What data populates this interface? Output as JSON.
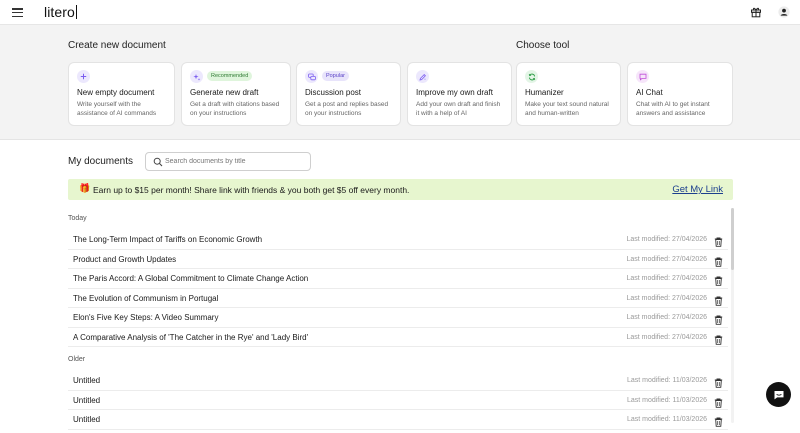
{
  "app": {
    "logo": "litero"
  },
  "create": {
    "title": "Create new document",
    "cards": [
      {
        "title": "New empty document",
        "desc": "Write yourself with the assistance of AI commands",
        "badge": "",
        "icon": "plus-icon",
        "icon_color": "#7a5cf0",
        "icon_bg": "#ece8fd"
      },
      {
        "title": "Generate new draft",
        "desc": "Get a draft with citations based on your instructions",
        "badge": "Recommended",
        "badge_bg": "#dff5dc",
        "badge_color": "#2f7a33",
        "icon": "sparkle-icon",
        "icon_color": "#7a5cf0",
        "icon_bg": "#ece8fd"
      },
      {
        "title": "Discussion post",
        "desc": "Get a post and replies based on your instructions",
        "badge": "Popular",
        "badge_bg": "#e8e4fb",
        "badge_color": "#5a42c7",
        "icon": "chat-bubbles-icon",
        "icon_color": "#7a5cf0",
        "icon_bg": "#ece8fd"
      },
      {
        "title": "Improve my own draft",
        "desc": "Add your own draft and finish it with a help of AI",
        "badge": "",
        "icon": "edit-sparkle-icon",
        "icon_color": "#7a5cf0",
        "icon_bg": "#ece8fd"
      }
    ]
  },
  "tools": {
    "title": "Choose tool",
    "cards": [
      {
        "title": "Humanizer",
        "desc": "Make your text sound natural and human-written",
        "icon": "refresh-icon",
        "icon_color": "#2e9d47",
        "icon_bg": "#e3f5e6"
      },
      {
        "title": "AI Chat",
        "desc": "Chat with AI to get instant answers and assistance",
        "icon": "message-icon",
        "icon_color": "#c04fd8",
        "icon_bg": "#f6e5fa"
      }
    ]
  },
  "documents": {
    "title": "My documents",
    "search_placeholder": "Search documents by title",
    "promo": {
      "text": "Earn up to $15 per month! Share link with friends & you both get $5 off every month.",
      "link": "Get My Link",
      "gift_icon": "gift-icon"
    },
    "groups": [
      {
        "label": "Today",
        "items": [
          {
            "title": "The Long-Term Impact of Tariffs on Economic Growth",
            "modified": "Last modified: 27/04/2026"
          },
          {
            "title": "Product and Growth Updates",
            "modified": "Last modified: 27/04/2026"
          },
          {
            "title": "The Paris Accord: A Global Commitment to Climate Change Action",
            "modified": "Last modified: 27/04/2026"
          },
          {
            "title": "The Evolution of Communism in Portugal",
            "modified": "Last modified: 27/04/2026"
          },
          {
            "title": "Elon's Five Key Steps: A Video Summary",
            "modified": "Last modified: 27/04/2026"
          },
          {
            "title": "A Comparative Analysis of 'The Catcher in the Rye' and 'Lady Bird'",
            "modified": "Last modified: 27/04/2026"
          }
        ]
      },
      {
        "label": "Older",
        "items": [
          {
            "title": "Untitled",
            "modified": "Last modified: 11/03/2026"
          },
          {
            "title": "Untitled",
            "modified": "Last modified: 11/03/2026"
          },
          {
            "title": "Untitled",
            "modified": "Last modified: 11/03/2026"
          }
        ]
      }
    ]
  }
}
